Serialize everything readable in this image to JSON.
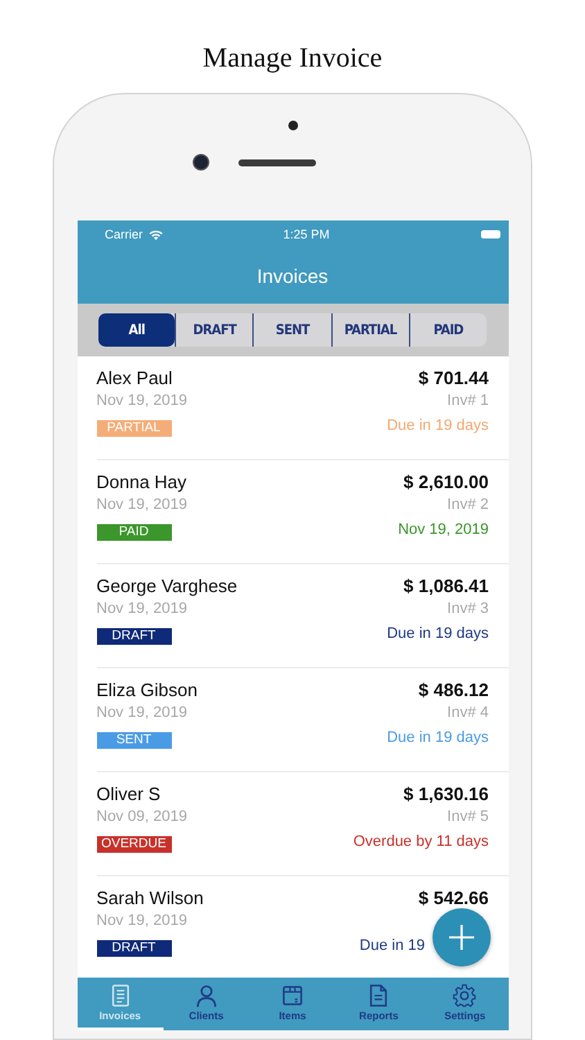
{
  "heading": "Manage Invoice",
  "status_bar": {
    "carrier": "Carrier",
    "time": "1:25 PM"
  },
  "nav": {
    "title": "Invoices"
  },
  "filters": [
    {
      "label": "All",
      "selected": true
    },
    {
      "label": "DRAFT",
      "selected": false
    },
    {
      "label": "SENT",
      "selected": false
    },
    {
      "label": "PARTIAL",
      "selected": false
    },
    {
      "label": "PAID",
      "selected": false
    }
  ],
  "invoices": [
    {
      "client": "Alex Paul",
      "amount": "$ 701.44",
      "date": "Nov 19, 2019",
      "number": "Inv# 1",
      "kind": "partial",
      "badge": "PARTIAL",
      "due": "Due in 19 days"
    },
    {
      "client": "Donna Hay",
      "amount": "$ 2,610.00",
      "date": "Nov 19, 2019",
      "number": "Inv# 2",
      "kind": "paid",
      "badge": "PAID",
      "due": "Nov 19, 2019"
    },
    {
      "client": "George Varghese",
      "amount": "$ 1,086.41",
      "date": "Nov 19, 2019",
      "number": "Inv# 3",
      "kind": "draft",
      "badge": "DRAFT",
      "due": "Due in 19 days"
    },
    {
      "client": "Eliza Gibson",
      "amount": "$ 486.12",
      "date": "Nov 19, 2019",
      "number": "Inv# 4",
      "kind": "sent",
      "badge": "SENT",
      "due": "Due in 19 days"
    },
    {
      "client": "Oliver S",
      "amount": "$ 1,630.16",
      "date": "Nov 09, 2019",
      "number": "Inv# 5",
      "kind": "overdue",
      "badge": "OVERDUE",
      "due": "Overdue by 11 days"
    },
    {
      "client": "Sarah Wilson",
      "amount": "$ 542.66",
      "date": "Nov 19, 2019",
      "kind": "draft",
      "badge": "DRAFT",
      "due": "Due in 19"
    }
  ],
  "tab_bar": [
    {
      "label": "Invoices",
      "kind": "invoices",
      "selected": true
    },
    {
      "label": "Clients",
      "kind": "clients",
      "selected": false
    },
    {
      "label": "Items",
      "kind": "items",
      "selected": false
    },
    {
      "label": "Reports",
      "kind": "reports",
      "selected": false
    },
    {
      "label": "Settings",
      "kind": "settings",
      "selected": false
    }
  ]
}
